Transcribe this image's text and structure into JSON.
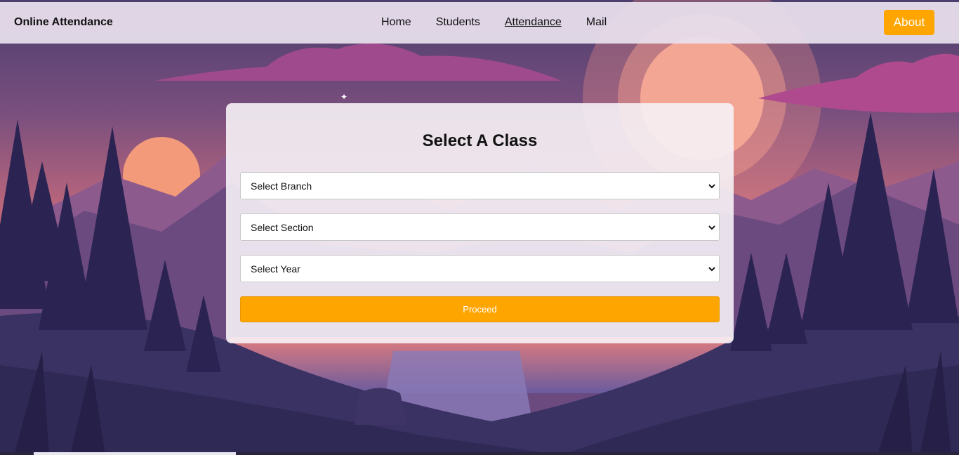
{
  "navbar": {
    "brand": "Online Attendance",
    "links": {
      "home": "Home",
      "students": "Students",
      "attendance": "Attendance",
      "mail": "Mail"
    },
    "about_label": "About",
    "active_link": "Attendance"
  },
  "form": {
    "title": "Select A Class",
    "branch_select": "Select Branch",
    "section_select": "Select Section",
    "year_select": "Select Year",
    "proceed_label": "Proceed"
  },
  "colors": {
    "accent": "#ffa500",
    "sky_top": "#5e4a7e",
    "sun": "#f08a76"
  },
  "icons": {
    "select_arrow": "chevron-down-icon"
  }
}
